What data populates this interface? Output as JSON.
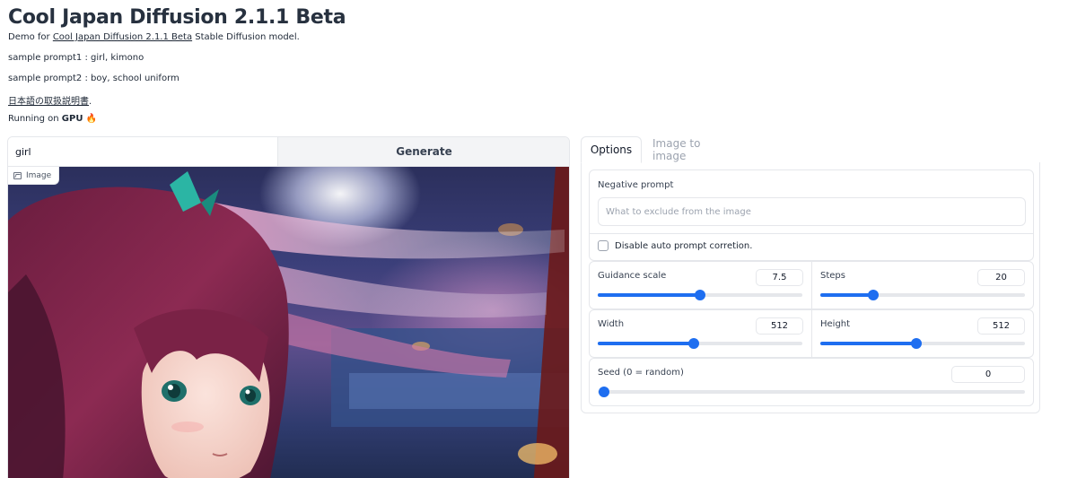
{
  "header": {
    "title": "Cool Japan Diffusion 2.1.1 Beta",
    "demo_prefix": "Demo for ",
    "demo_link": "Cool Japan Diffusion 2.1.1 Beta",
    "demo_suffix": " Stable Diffusion model.",
    "sample1": "sample prompt1 : girl, kimono",
    "sample2": "sample prompt2 : boy, school uniform",
    "manual_link": "日本語の取扱説明書",
    "manual_suffix": ".",
    "running_prefix": "Running on ",
    "running_device": "GPU",
    "running_icon": "🔥"
  },
  "left": {
    "prompt_value": "girl",
    "generate_label": "Generate",
    "image_label": "Image"
  },
  "tabs": {
    "options": "Options",
    "img2img": "Image to image"
  },
  "options": {
    "negative_label": "Negative prompt",
    "negative_placeholder": "What to exclude from the image",
    "negative_value": "",
    "disable_auto_label": "Disable auto prompt corretion.",
    "guidance": {
      "label": "Guidance scale",
      "value": "7.5",
      "fraction": 0.5
    },
    "steps": {
      "label": "Steps",
      "value": "20",
      "fraction": 0.26
    },
    "width": {
      "label": "Width",
      "value": "512",
      "fraction": 0.47
    },
    "height": {
      "label": "Height",
      "value": "512",
      "fraction": 0.47
    },
    "seed": {
      "label": "Seed (0 = random)",
      "value": "0",
      "fraction": 0.0
    }
  },
  "colors": {
    "accent": "#1e6ef0",
    "fire": "#f97316"
  }
}
